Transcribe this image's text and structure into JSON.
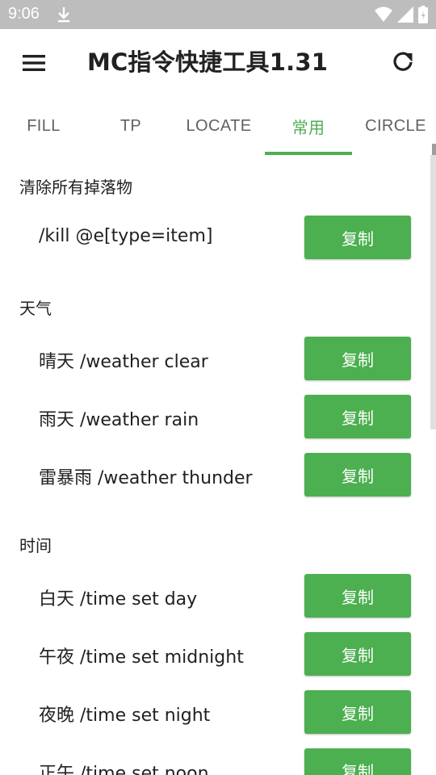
{
  "status_bar": {
    "time": "9:06"
  },
  "app_bar": {
    "title": "MC指令快捷工具1.31"
  },
  "tabs": [
    {
      "label": "FILL"
    },
    {
      "label": "TP"
    },
    {
      "label": "LOCATE"
    },
    {
      "label": "常用"
    },
    {
      "label": "CIRCLE"
    }
  ],
  "active_tab": "常用",
  "copy_label": "复制",
  "sections": [
    {
      "title": "清除所有掉落物",
      "items": [
        {
          "text": "/kill @e[type=item]"
        }
      ]
    },
    {
      "title": "天气",
      "items": [
        {
          "text": "晴天 /weather clear"
        },
        {
          "text": "雨天 /weather rain"
        },
        {
          "text": "雷暴雨 /weather thunder"
        }
      ]
    },
    {
      "title": "时间",
      "items": [
        {
          "text": "白天 /time set day"
        },
        {
          "text": "午夜 /time set midnight"
        },
        {
          "text": "夜晚 /time set night"
        },
        {
          "text": "正午 /time set noon"
        }
      ]
    }
  ],
  "colors": {
    "accent": "#4caf50",
    "status_bar": "#bdbdbd",
    "text": "#212121",
    "tab_text": "#616161"
  }
}
